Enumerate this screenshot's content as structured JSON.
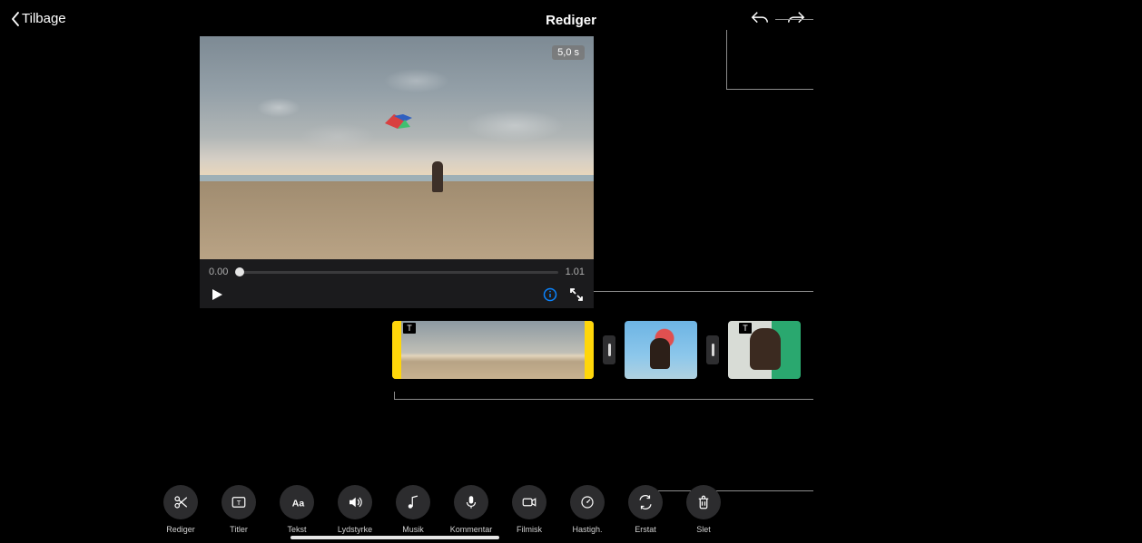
{
  "header": {
    "back_label": "Tilbage",
    "title": "Rediger"
  },
  "preview": {
    "duration_badge": "5,0 s",
    "time_start": "0.00",
    "time_end": "1.01"
  },
  "timeline": {
    "clips": [
      {
        "has_title_overlay": true,
        "selected": true
      },
      {
        "has_title_overlay": false,
        "selected": false
      },
      {
        "has_title_overlay": true,
        "selected": false
      }
    ]
  },
  "toolbar": {
    "items": [
      {
        "id": "edit",
        "label": "Rediger",
        "icon": "scissors"
      },
      {
        "id": "titles",
        "label": "Titler",
        "icon": "title-frame"
      },
      {
        "id": "text",
        "label": "Tekst",
        "icon": "font"
      },
      {
        "id": "volume",
        "label": "Lydstyrke",
        "icon": "speaker"
      },
      {
        "id": "music",
        "label": "Musik",
        "icon": "note"
      },
      {
        "id": "voice",
        "label": "Kommentar",
        "icon": "mic"
      },
      {
        "id": "filmic",
        "label": "Filmisk",
        "icon": "camera"
      },
      {
        "id": "speed",
        "label": "Hastigh.",
        "icon": "gauge"
      },
      {
        "id": "replace",
        "label": "Erstat",
        "icon": "swap"
      },
      {
        "id": "delete",
        "label": "Slet",
        "icon": "trash"
      }
    ]
  }
}
